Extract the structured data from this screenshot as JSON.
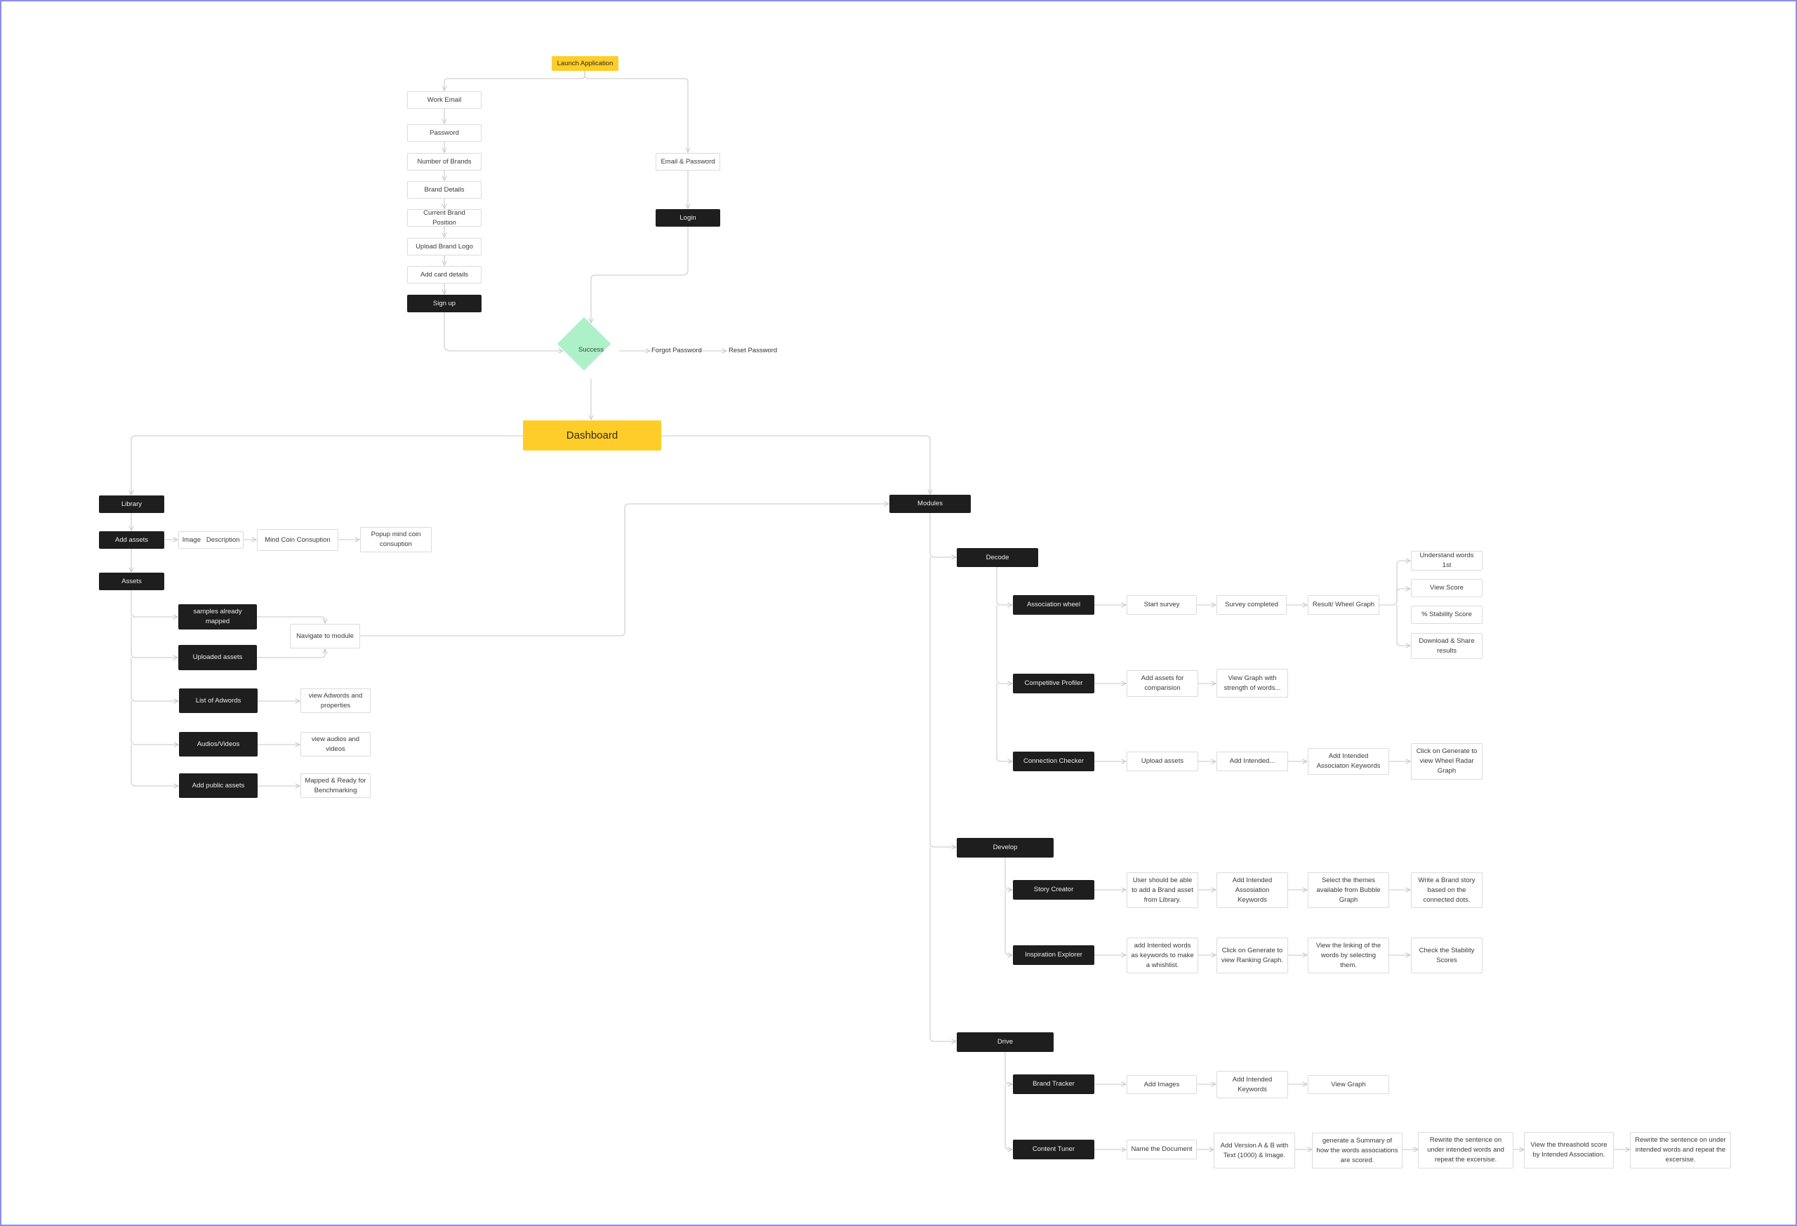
{
  "colors": {
    "start": "#ffcd29",
    "decision": "#aef0c8",
    "dark_node": "#1e1e1e",
    "connector": "#cfcfcf",
    "frame": "#8c8cf2"
  },
  "onboarding": {
    "launch": "Launch Application",
    "signup_steps": [
      "Work Email",
      "Password",
      "Number of Brands",
      "Brand Details",
      "Current Brand Position",
      "Upload Brand Logo",
      "Add card details"
    ],
    "signup": "Sign up",
    "login_steps": [
      "Email & Password"
    ],
    "login": "Login",
    "decision": "Success",
    "forgot_password": "Forgot Password",
    "reset_password": "Reset Password"
  },
  "dashboard": "Dashboard",
  "library": {
    "title": "Library",
    "add_assets": "Add assets",
    "add_assets_flow": [
      "Image   Description",
      "Mind Coin Consuption",
      "Popup mind coin consuption"
    ],
    "assets": "Assets",
    "asset_items": [
      {
        "label": "samples already mapped",
        "next": "Navigate to module"
      },
      {
        "label": "Uploaded assets",
        "next": "Navigate to module"
      },
      {
        "label": "List of Adwords",
        "next": "view Adwords and properties"
      },
      {
        "label": "Audios/Videos",
        "next": "view audios and videos"
      },
      {
        "label": "Add public assets",
        "next": "Mapped & Ready for Benchmarking"
      }
    ],
    "navigate": "Navigate to module"
  },
  "modules": {
    "title": "Modules",
    "groups": [
      {
        "name": "Decode",
        "items": [
          {
            "name": "Association wheel",
            "steps": [
              "Start survey",
              "Survey completed",
              "Result/ Wheel Graph"
            ],
            "results": [
              "Understand words 1st",
              "View Score",
              "% Stability Score",
              "Download & Share results"
            ]
          },
          {
            "name": "Competitive Profiler",
            "steps": [
              "Add assets for comparision",
              "View Graph with strength of words..."
            ]
          },
          {
            "name": "Connection Checker",
            "steps": [
              "Upload assets",
              "Add Intended...",
              "Add Intended Associaton Keywords",
              "Click on Generate to view Wheel Radar Graph"
            ]
          }
        ]
      },
      {
        "name": "Develop",
        "items": [
          {
            "name": "Story Creator",
            "steps": [
              "User should be able to add a Brand asset from Library.",
              "Add Intended Assosiation Keywords",
              "Select the themes available from Bubble Graph",
              "Write a Brand story based on the connected dots."
            ]
          },
          {
            "name": "Inspiration Explorer",
            "steps": [
              "add Intented words as keywords to make a whishlist.",
              "Click on Generate to view Ranking Graph.",
              "View the linking of the words by selecting them.",
              "Check the Stability Scores"
            ]
          }
        ]
      },
      {
        "name": "Drive",
        "items": [
          {
            "name": "Brand Tracker",
            "steps": [
              "Add Images",
              "Add Intended Keywords",
              "View Graph"
            ]
          },
          {
            "name": "Content Tuner",
            "steps": [
              "Name the Document",
              "Add Version A & B with Text (1000)  & Image.",
              "generate a Summary of how the words associations are scored.",
              "Rewrite the sentence on under intended words and repeat the excersise.",
              "View the threashold score by Intended Association.",
              "Rewrite the sentence on under intended words and repeat the excersise."
            ]
          }
        ]
      }
    ]
  }
}
